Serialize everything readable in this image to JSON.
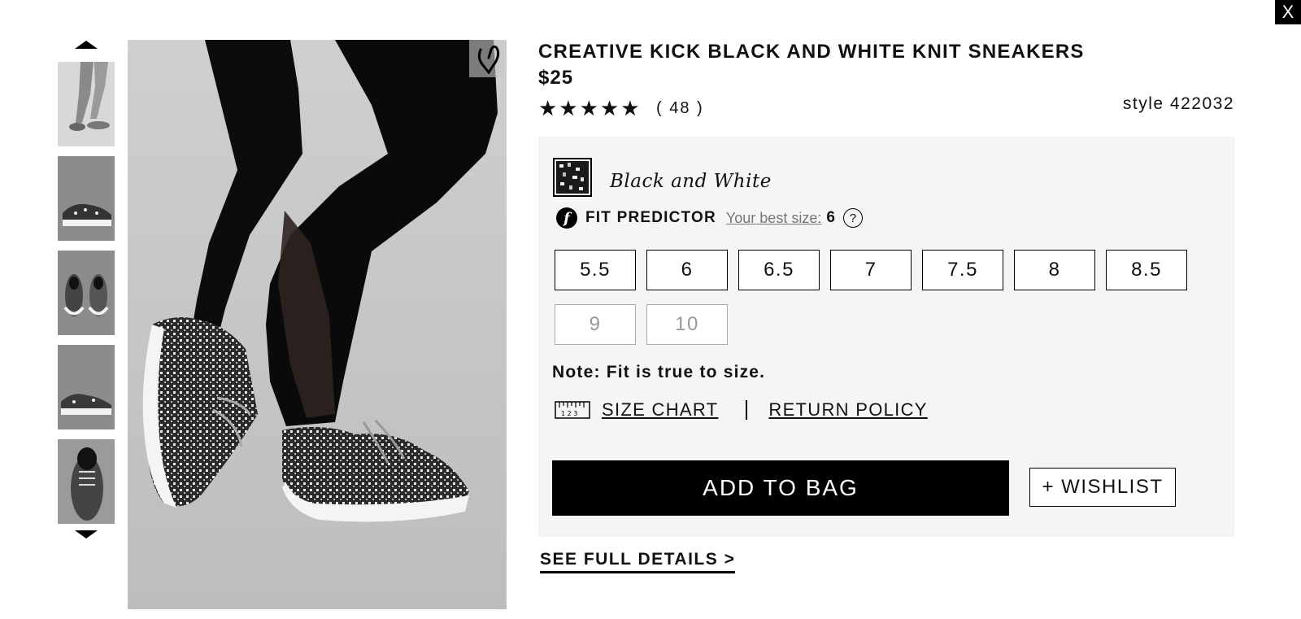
{
  "close": {
    "label": "X"
  },
  "product": {
    "title": "CREATIVE KICK BLACK AND WHITE KNIT SNEAKERS",
    "price": "$25",
    "rating_stars": "★★★★★",
    "rating_value": 5,
    "review_count": "( 48 )",
    "style_number": "style 422032"
  },
  "color": {
    "name": "Black and White"
  },
  "fit_predictor": {
    "label": "FIT PREDICTOR",
    "logo_letter": "f",
    "best_size_label": "Your best size:",
    "best_size_value": "6",
    "help": "?"
  },
  "sizes": [
    {
      "label": "5.5",
      "available": true
    },
    {
      "label": "6",
      "available": true
    },
    {
      "label": "6.5",
      "available": true
    },
    {
      "label": "7",
      "available": true
    },
    {
      "label": "7.5",
      "available": true
    },
    {
      "label": "8",
      "available": true
    },
    {
      "label": "8.5",
      "available": true
    },
    {
      "label": "9",
      "available": false
    },
    {
      "label": "10",
      "available": false
    }
  ],
  "note": "Note: Fit is true to size.",
  "links": {
    "size_chart": "SIZE CHART",
    "return_policy": "RETURN POLICY",
    "ruler_digits": "1 2 3"
  },
  "actions": {
    "add_to_bag": "ADD TO BAG",
    "wishlist": "+ WISHLIST",
    "see_full_details": "SEE FULL DETAILS >"
  },
  "icons": {
    "close": "close-icon",
    "favorite": "heart-icon",
    "scroll_up": "chevron-up-icon",
    "scroll_down": "chevron-down-icon",
    "ruler": "ruler-icon",
    "help": "help-icon"
  }
}
